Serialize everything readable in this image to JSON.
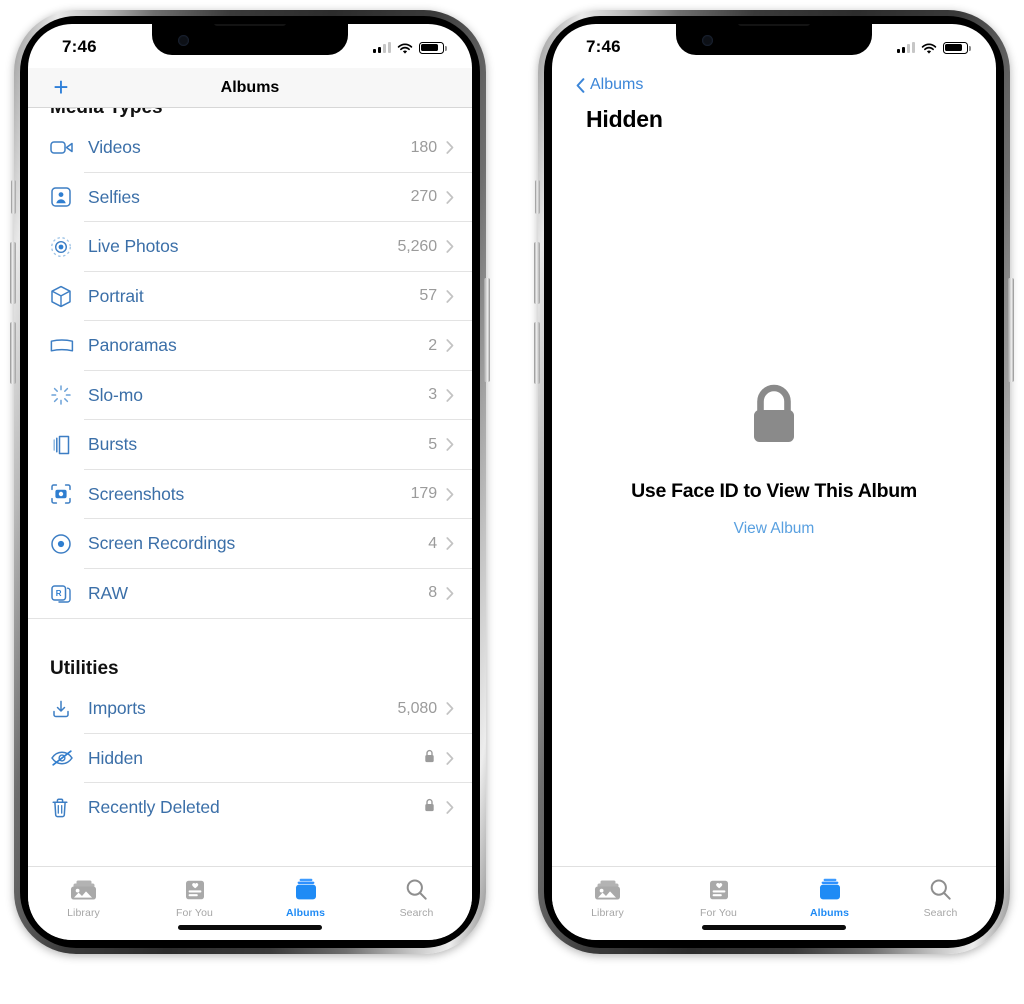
{
  "meta": {
    "accent_blue": "#1f8bf5",
    "label_blue": "#3b6fa8",
    "link_blue": "#3c86d8",
    "count_gray": "#9b9b9b"
  },
  "phone_left": {
    "status": {
      "time": "7:46",
      "signal_icon": "cellular-bars-icon",
      "wifi_icon": "wifi-icon",
      "battery_icon": "battery-icon"
    },
    "navbar": {
      "title": "Albums",
      "add_label": "+",
      "add_icon": "plus-icon"
    },
    "sections": [
      {
        "header": "Media Types",
        "clipped": true,
        "rows": [
          {
            "icon": "video-camera-icon",
            "label": "Videos",
            "count": "180"
          },
          {
            "icon": "selfie-person-icon",
            "label": "Selfies",
            "count": "270"
          },
          {
            "icon": "live-photo-icon",
            "label": "Live Photos",
            "count": "5,260"
          },
          {
            "icon": "portrait-cube-icon",
            "label": "Portrait",
            "count": "57"
          },
          {
            "icon": "panorama-icon",
            "label": "Panoramas",
            "count": "2"
          },
          {
            "icon": "slo-mo-icon",
            "label": "Slo-mo",
            "count": "3"
          },
          {
            "icon": "bursts-icon",
            "label": "Bursts",
            "count": "5"
          },
          {
            "icon": "screenshots-icon",
            "label": "Screenshots",
            "count": "179"
          },
          {
            "icon": "screen-recording-icon",
            "label": "Screen Recordings",
            "count": "4"
          },
          {
            "icon": "raw-icon",
            "label": "RAW",
            "count": "8"
          }
        ]
      },
      {
        "header": "Utilities",
        "clipped": false,
        "rows": [
          {
            "icon": "imports-icon",
            "label": "Imports",
            "count": "5,080"
          },
          {
            "icon": "hidden-eye-icon",
            "label": "Hidden",
            "count": "",
            "locked": true
          },
          {
            "icon": "trash-icon",
            "label": "Recently Deleted",
            "count": "",
            "locked": true
          }
        ]
      }
    ],
    "tabbar": [
      {
        "icon": "library-photos-icon",
        "label": "Library",
        "active": false
      },
      {
        "icon": "for-you-card-icon",
        "label": "For You",
        "active": false
      },
      {
        "icon": "albums-stack-icon",
        "label": "Albums",
        "active": true
      },
      {
        "icon": "search-magnifier-icon",
        "label": "Search",
        "active": false
      }
    ]
  },
  "phone_right": {
    "status": {
      "time": "7:46",
      "signal_icon": "cellular-bars-icon",
      "wifi_icon": "wifi-icon",
      "battery_icon": "battery-icon"
    },
    "navbar": {
      "back_label": "Albums",
      "back_icon": "chevron-left-icon"
    },
    "page_title": "Hidden",
    "locked_state": {
      "lock_icon": "lock-closed-icon",
      "headline": "Use Face ID to View This Album",
      "action_label": "View Album"
    },
    "tabbar": [
      {
        "icon": "library-photos-icon",
        "label": "Library",
        "active": false
      },
      {
        "icon": "for-you-card-icon",
        "label": "For You",
        "active": false
      },
      {
        "icon": "albums-stack-icon",
        "label": "Albums",
        "active": true
      },
      {
        "icon": "search-magnifier-icon",
        "label": "Search",
        "active": false
      }
    ]
  }
}
